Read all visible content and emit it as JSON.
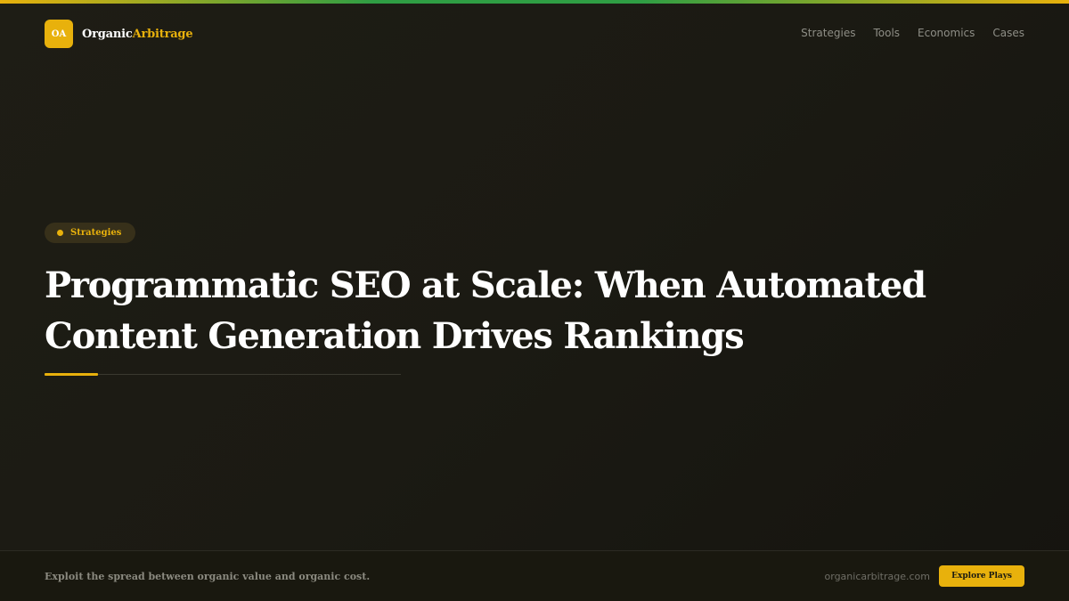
{
  "colors": {
    "accent": "#e8b10c",
    "green": "#2f9e44",
    "background": "#1b1a13",
    "nav_text": "#8e8e86"
  },
  "brand": {
    "badge": "OA",
    "name_part1": "Organic",
    "name_part2": "Arbitrage"
  },
  "nav": {
    "items": [
      "Strategies",
      "Tools",
      "Economics",
      "Cases"
    ]
  },
  "article": {
    "category": "Strategies",
    "title": "Programmatic SEO at Scale: When Automated Content Generation Drives Rankings"
  },
  "footer": {
    "tagline": "Exploit the spread between organic value and organic cost.",
    "domain": "organicarbitrage.com",
    "cta_label": "Explore Plays"
  }
}
